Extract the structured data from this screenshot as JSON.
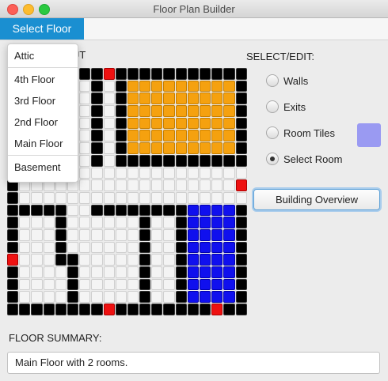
{
  "window": {
    "title": "Floor Plan Builder"
  },
  "menu": {
    "label": "Select Floor",
    "items": [
      "Attic",
      "4th Floor",
      "3rd Floor",
      "2nd Floor",
      "Main Floor",
      "Basement"
    ]
  },
  "layout_label_partial": "UT",
  "select_edit": {
    "label": "SELECT/EDIT:",
    "options": [
      {
        "label": "Walls",
        "selected": false
      },
      {
        "label": "Exits",
        "selected": false
      },
      {
        "label": "Room Tiles",
        "selected": false
      },
      {
        "label": "Select Room",
        "selected": true
      }
    ],
    "room_tile_color": "#9a9af2"
  },
  "overview_button": "Building Overview",
  "summary": {
    "label": "FLOOR SUMMARY:",
    "text": "Main Floor with 2 rooms."
  },
  "floor_grid": {
    "legend": {
      "0": "empty",
      "W": "wall",
      "E": "exit",
      "O": "room-orange",
      "B": "room-blue"
    },
    "colors": {
      "wall": "#000000",
      "exit": "#ee1111",
      "room-orange": "#f5a10f",
      "room-blue": "#1010ee",
      "empty": "#f4f4f4"
    },
    "rows": [
      "WWWWWWWWEWWWWWWWWWWW",
      "W000000W0WOOOOOOOOOW",
      "W000000W0WOOOOOOOOOW",
      "W000000W0WOOOOOOOOOW",
      "W000000W0WOOOOOOOOOW",
      "W000000W0WOOOOOOOOOW",
      "W000000W0WOOOOOOOOOW",
      "W000000W0WWWWWWWWWWW",
      "W0000000000000000000",
      "W000000000000000000E",
      "W0000000000000000000",
      "WWWWW00WWWWWWWWBBBBW",
      "W000W000000W00WBBBBW",
      "W000W000000W00WBBBBW",
      "W000W000000W00WBBBBW",
      "E000WW00000W00WBBBBW",
      "W0000W00000W00WBBBBW",
      "W0000W00000W00WBBBBW",
      "W0000W00000W00WBBBBW",
      "WWWWWWWWEWWWWWWWWEWW"
    ]
  }
}
